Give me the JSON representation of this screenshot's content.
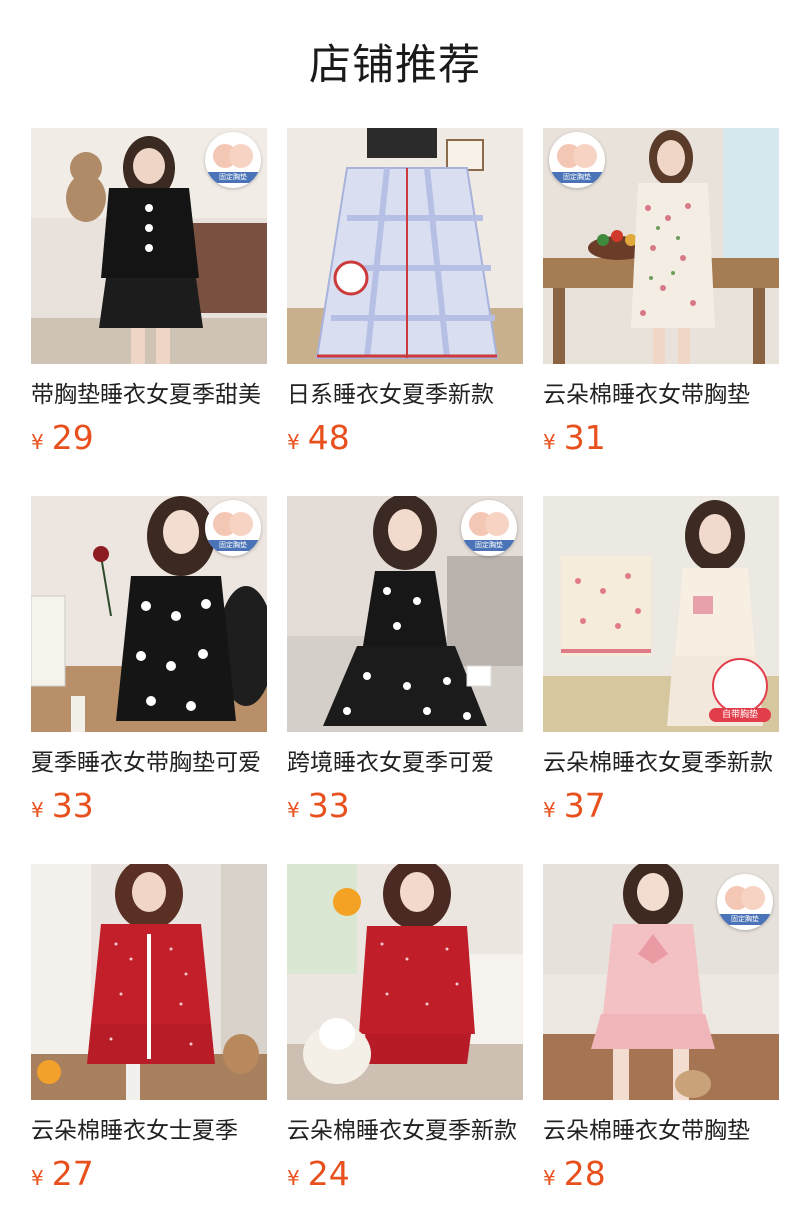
{
  "section": {
    "title": "店铺推荐"
  },
  "badges": {
    "pad_badge_text": "固定胸垫",
    "self_pad_text": "自带胸垫"
  },
  "products": [
    {
      "title": "带胸垫睡衣女夏季甜美",
      "currency": "¥",
      "price": "29"
    },
    {
      "title": "日系睡衣女夏季新款",
      "currency": "¥",
      "price": "48"
    },
    {
      "title": "云朵棉睡衣女带胸垫",
      "currency": "¥",
      "price": "31"
    },
    {
      "title": "夏季睡衣女带胸垫可爱",
      "currency": "¥",
      "price": "33"
    },
    {
      "title": "跨境睡衣女夏季可爱",
      "currency": "¥",
      "price": "33"
    },
    {
      "title": "云朵棉睡衣女夏季新款",
      "currency": "¥",
      "price": "37"
    },
    {
      "title": "云朵棉睡衣女士夏季",
      "currency": "¥",
      "price": "27"
    },
    {
      "title": "云朵棉睡衣女夏季新款",
      "currency": "¥",
      "price": "24"
    },
    {
      "title": "云朵棉睡衣女带胸垫",
      "currency": "¥",
      "price": "28"
    }
  ],
  "colors": {
    "price": "#e8501d",
    "title_text": "#222222",
    "badge_ribbon": "#4a73b8",
    "self_pad_tag": "#e23d4a"
  }
}
